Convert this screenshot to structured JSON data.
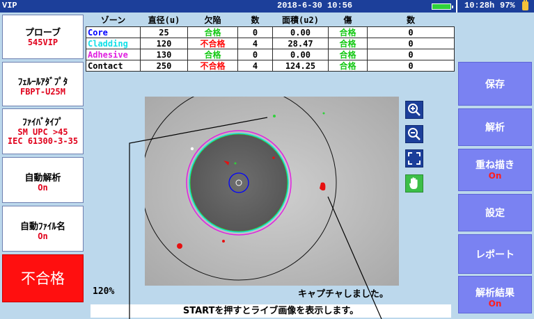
{
  "titlebar": {
    "app": "VIP",
    "datetime": "2018-6-30 10:56",
    "battery_time": "10:28h",
    "battery_pct": "97%"
  },
  "left_panel": {
    "probe": {
      "title": "プローブ",
      "value": "545VIP"
    },
    "adapter": {
      "title": "ﾌｪﾙｰﾙｱﾀﾞﾌﾟﾀ",
      "value": "FBPT-U25M"
    },
    "fiber_type": {
      "title": "ﾌｧｲﾊﾞﾀｲﾌﾟ",
      "value1": "SM UPC >45",
      "value2": "IEC 61300-3-35"
    },
    "auto_analysis": {
      "title": "自動解析",
      "value": "On"
    },
    "auto_filename": {
      "title": "自動ﾌｧｲﾙ名",
      "value": "On"
    },
    "result": "不合格"
  },
  "table": {
    "headers": [
      "ゾーン",
      "直径(u)",
      "欠陥",
      "数",
      "面積(u2)",
      "傷",
      "数"
    ],
    "rows": [
      {
        "zone": "Core",
        "diameter": "25",
        "defect": "合格",
        "count": "0",
        "area": "0.00",
        "scratch": "合格",
        "scount": "0"
      },
      {
        "zone": "Cladding",
        "diameter": "120",
        "defect": "不合格",
        "count": "4",
        "area": "28.47",
        "scratch": "合格",
        "scount": "0"
      },
      {
        "zone": "Adhesive",
        "diameter": "130",
        "defect": "合格",
        "count": "0",
        "area": "0.00",
        "scratch": "合格",
        "scount": "0"
      },
      {
        "zone": "Contact",
        "diameter": "250",
        "defect": "不合格",
        "count": "4",
        "area": "124.25",
        "scratch": "合格",
        "scount": "0"
      }
    ]
  },
  "colors": {
    "pass": "#17c917",
    "fail": "#ff0a0a",
    "core": "#0000ff",
    "cladding": "#12e0e8",
    "adhesive": "#e020e0",
    "contact": "#000000"
  },
  "view_tools": [
    "zoom-in-icon",
    "zoom-out-icon",
    "fit-screen-icon",
    "hand-pan-icon"
  ],
  "right_panel": {
    "save": "保存",
    "analyze": "解析",
    "overlay": {
      "title": "重ね描き",
      "value": "On"
    },
    "settings": "設定",
    "report": "レポート",
    "results": {
      "title": "解析結果",
      "value": "On"
    }
  },
  "zoom_level": "120%",
  "status_message": "キャプチャしました。",
  "info_message": "STARTを押すとライブ画像を表示します。"
}
